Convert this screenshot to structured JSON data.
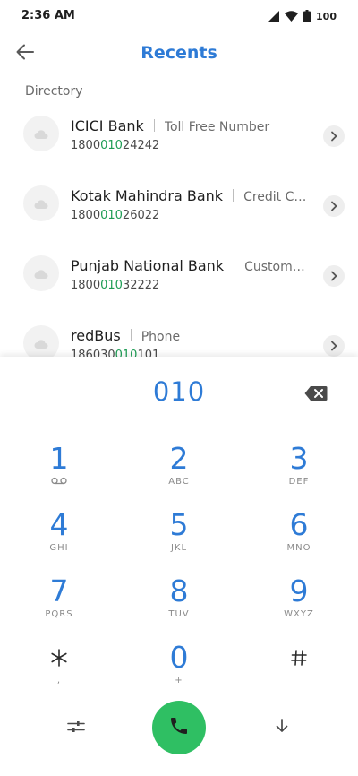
{
  "status_bar": {
    "time": "2:36 AM",
    "battery": "100",
    "icons": [
      "signal-icon",
      "wifi-icon",
      "battery-icon"
    ]
  },
  "header": {
    "title": "Recents",
    "back_icon": "arrow-left-icon"
  },
  "directory": {
    "label": "Directory",
    "contacts": [
      {
        "name": "ICICI Bank",
        "type": "Toll Free Number",
        "number_pre": "1800",
        "number_match": "010",
        "number_post": "24242"
      },
      {
        "name": "Kotak Mahindra Bank",
        "type": "Credit Card/...",
        "number_pre": "1800",
        "number_match": "010",
        "number_post": "26022"
      },
      {
        "name": "Punjab National Bank",
        "type": "Customer C...",
        "number_pre": "1800",
        "number_match": "010",
        "number_post": "32222"
      },
      {
        "name": "redBus",
        "type": "Phone",
        "number_pre": "186030",
        "number_match": "010",
        "number_post": "101"
      }
    ]
  },
  "dialpad": {
    "display": "010",
    "keys": [
      {
        "digit": "1",
        "letters": ""
      },
      {
        "digit": "2",
        "letters": "ABC"
      },
      {
        "digit": "3",
        "letters": "DEF"
      },
      {
        "digit": "4",
        "letters": "GHI"
      },
      {
        "digit": "5",
        "letters": "JKL"
      },
      {
        "digit": "6",
        "letters": "MNO"
      },
      {
        "digit": "7",
        "letters": "PQRS"
      },
      {
        "digit": "8",
        "letters": "TUV"
      },
      {
        "digit": "9",
        "letters": "WXYZ"
      },
      {
        "digit": "*",
        "letters": ","
      },
      {
        "digit": "0",
        "letters": "+"
      },
      {
        "digit": "#",
        "letters": ""
      }
    ]
  },
  "colors": {
    "accent": "#2e7bd6",
    "match_highlight": "#1e9d55",
    "call_button": "#2fbf63"
  }
}
